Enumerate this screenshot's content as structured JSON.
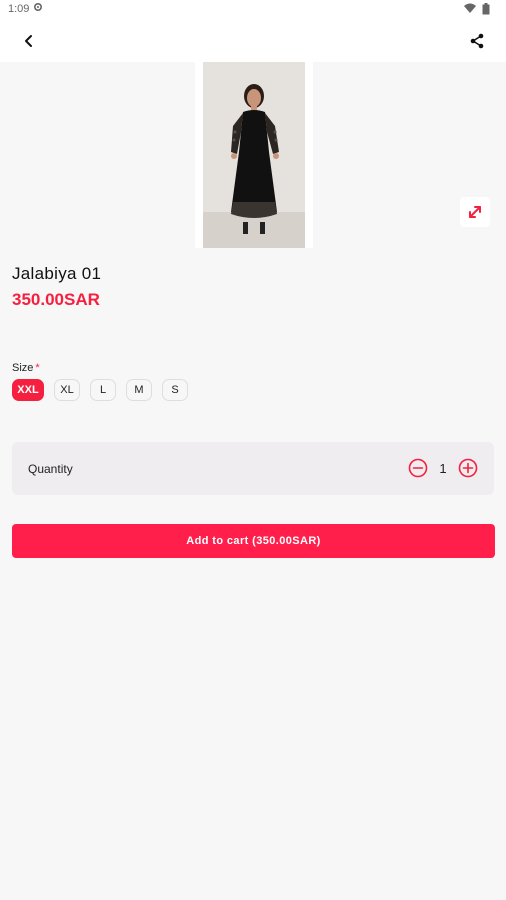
{
  "status_bar": {
    "time": "1:09",
    "icons": [
      "gear-icon",
      "wifi-icon",
      "battery-icon"
    ]
  },
  "app_bar": {
    "back_icon": "back-arrow-icon",
    "share_icon": "share-icon"
  },
  "product": {
    "title": "Jalabiya 01",
    "price": "350.00SAR",
    "image_icon": "expand-icon"
  },
  "size": {
    "label": "Size",
    "required_mark": "*",
    "options": [
      "XXL",
      "XL",
      "L",
      "M",
      "S"
    ],
    "selected": "XXL"
  },
  "quantity": {
    "label": "Quantity",
    "value": "1",
    "decrement_icon": "minus-circle-icon",
    "increment_icon": "plus-circle-icon"
  },
  "cart": {
    "button_label": "Add to cart (350.00SAR)"
  },
  "colors": {
    "accent": "#f5203f",
    "button": "#ff1f4a",
    "background": "#f7f7f7"
  }
}
